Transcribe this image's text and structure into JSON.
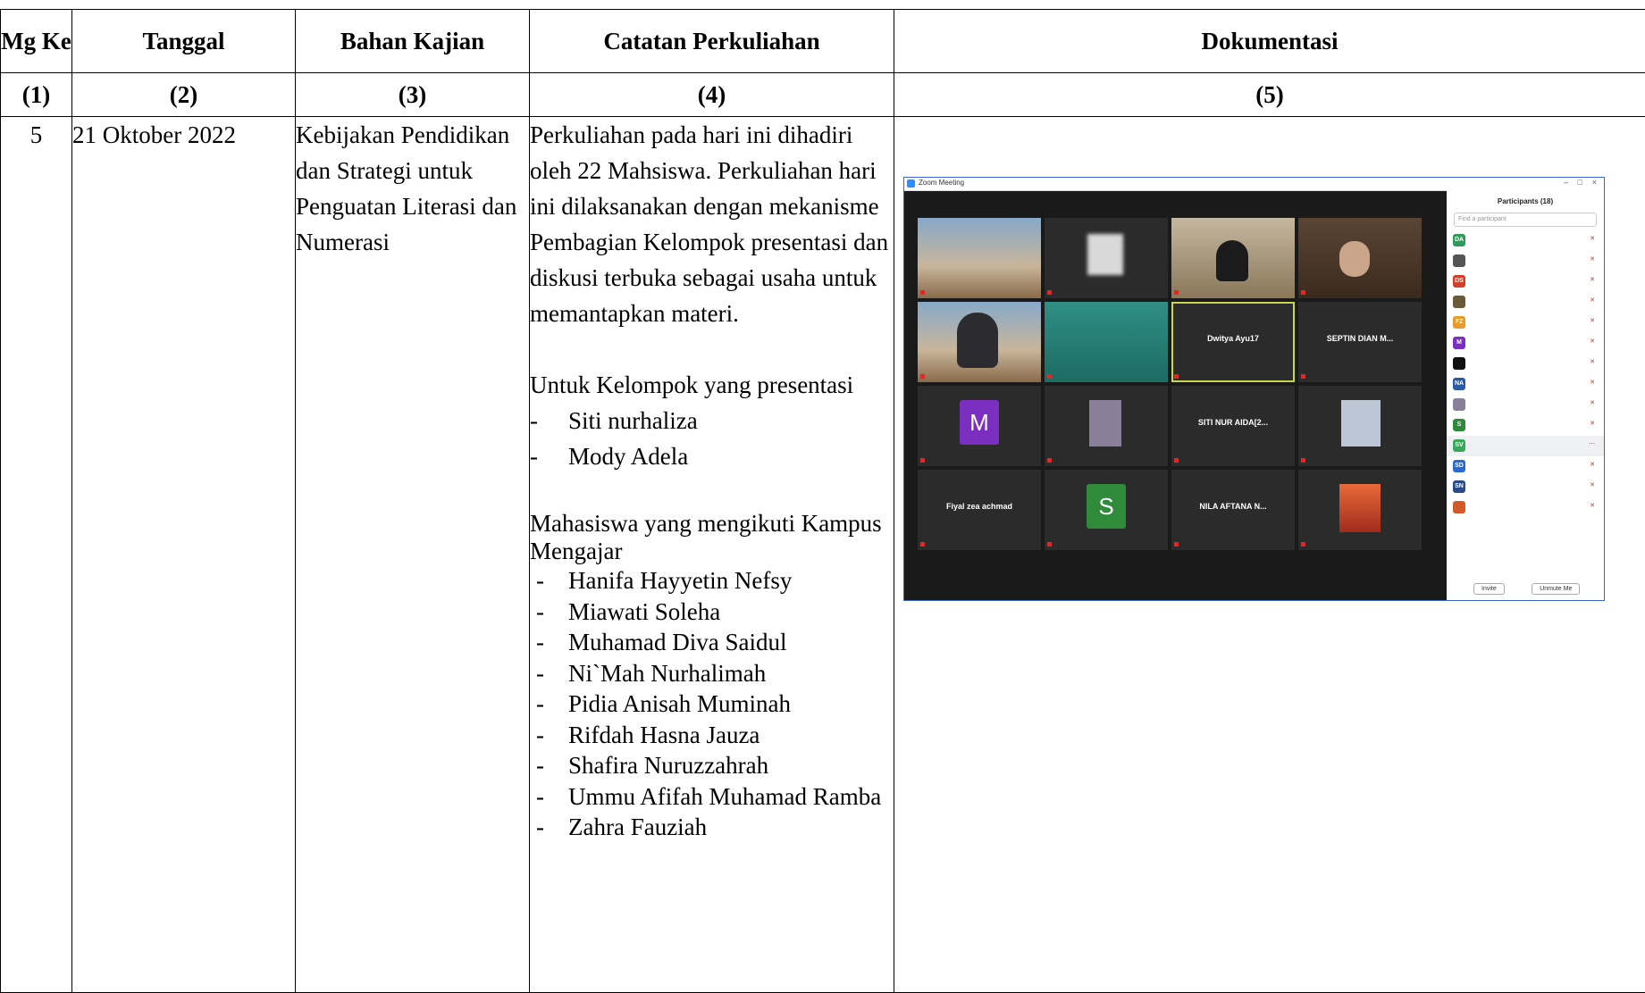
{
  "headers": {
    "mg": "Mg Ke",
    "tanggal": "Tanggal",
    "bahan": "Bahan Kajian",
    "catatan": "Catatan Perkuliahan",
    "dokumentasi": "Dokumentasi"
  },
  "col_numbers": [
    "(1)",
    "(2)",
    "(3)",
    "(4)",
    "(5)"
  ],
  "row": {
    "no": "5",
    "tanggal": "21 Oktober 2022",
    "bahan": "Kebijakan Pendidikan dan Strategi untuk Penguatan Literasi dan Numerasi",
    "catatan_p1": "Perkuliahan pada hari ini dihadiri oleh 22 Mahsiswa. Perkuliahan hari ini dilaksanakan dengan mekanisme Pembagian Kelompok presentasi dan diskusi terbuka sebagai usaha untuk memantapkan materi.",
    "catatan_p2": "Untuk Kelompok yang presentasi",
    "presenters": [
      "Siti nurhaliza",
      "Mody Adela"
    ],
    "catatan_p3": "Mahasiswa yang mengikuti Kampus Mengajar",
    "kampus_mengajar": [
      "Hanifa Hayyetin Nefsy",
      "Miawati Soleha",
      "Muhamad Diva Saidul",
      "Ni`Mah Nurhalimah",
      "Pidia Anisah Muminah",
      "Rifdah Hasna Jauza",
      "Shafira Nuruzzahrah",
      "Ummu Afifah Muhamad Ramba",
      "Zahra Fauziah"
    ]
  },
  "zoom": {
    "window_title": "Zoom Meeting",
    "panel_title": "Participants (18)",
    "search_placeholder": "Find a participant",
    "tile_center_names": [
      "Dwitya Ayu17",
      "SEPTIN DIAN M...",
      "SITI NUR AIDA[2...",
      "Fiyal zea achmad",
      "NILA AFTANA N..."
    ],
    "avatar_letters": [
      "M",
      "S"
    ],
    "buttons": [
      "Invite",
      "Unmute Me"
    ],
    "colors": {
      "accent": "#2d8cff",
      "avatar_m": "#7b2fc0",
      "avatar_s": "#2f8a3a",
      "active_outline": "#c8d84a"
    }
  }
}
